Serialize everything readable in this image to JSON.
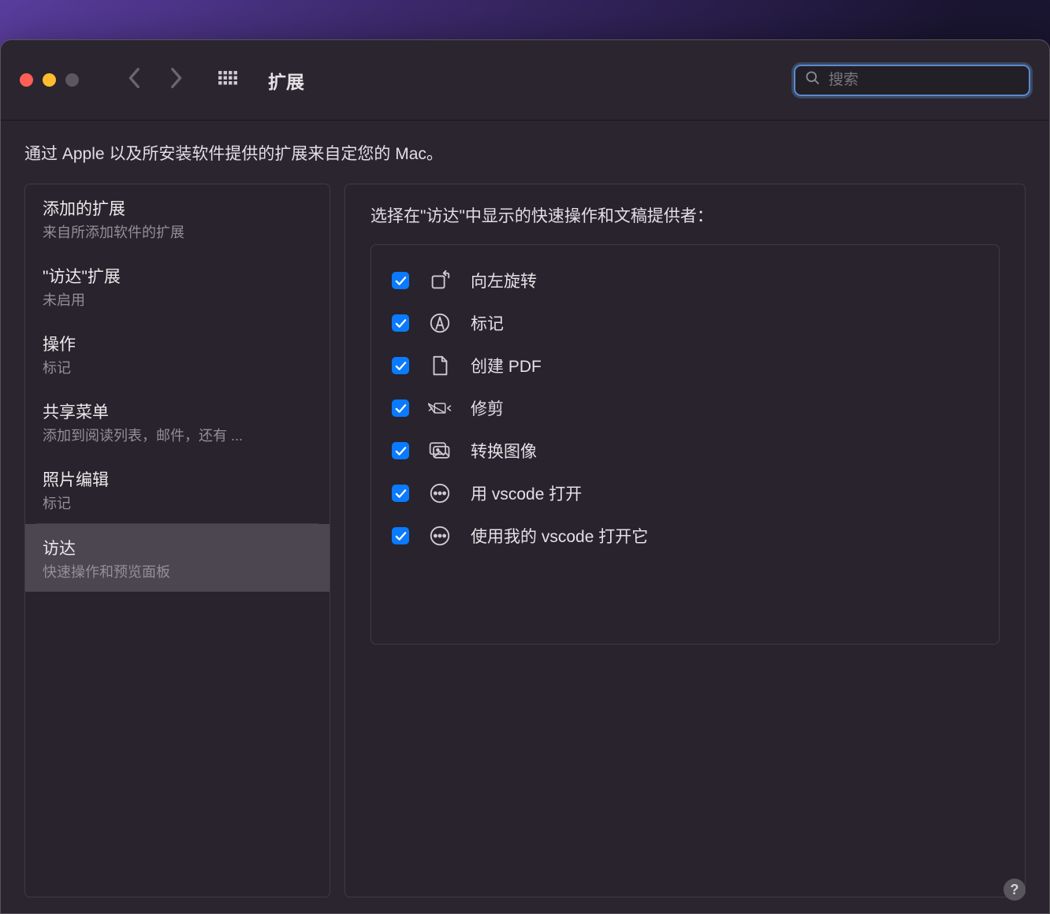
{
  "window": {
    "title": "扩展"
  },
  "search": {
    "placeholder": "搜索",
    "value": ""
  },
  "description": "通过 Apple 以及所安装软件提供的扩展来自定您的 Mac。",
  "sidebar": {
    "items": [
      {
        "title": "添加的扩展",
        "subtitle": "来自所添加软件的扩展",
        "selected": false
      },
      {
        "title": "\"访达\"扩展",
        "subtitle": "未启用",
        "selected": false
      },
      {
        "title": "操作",
        "subtitle": "标记",
        "selected": false
      },
      {
        "title": "共享菜单",
        "subtitle": "添加到阅读列表，邮件，还有 ...",
        "selected": false
      },
      {
        "title": "照片编辑",
        "subtitle": "标记",
        "selected": false
      },
      {
        "title": "访达",
        "subtitle": "快速操作和预览面板",
        "selected": true
      }
    ]
  },
  "main": {
    "heading": "选择在\"访达\"中显示的快速操作和文稿提供者：",
    "items": [
      {
        "label": "向左旋转",
        "checked": true,
        "icon": "rotate-left"
      },
      {
        "label": "标记",
        "checked": true,
        "icon": "markup"
      },
      {
        "label": "创建 PDF",
        "checked": true,
        "icon": "pdf"
      },
      {
        "label": "修剪",
        "checked": true,
        "icon": "trim"
      },
      {
        "label": "转换图像",
        "checked": true,
        "icon": "convert-image"
      },
      {
        "label": "用 vscode 打开",
        "checked": true,
        "icon": "ellipsis"
      },
      {
        "label": "使用我的 vscode 打开它",
        "checked": true,
        "icon": "ellipsis"
      }
    ]
  },
  "help": {
    "label": "?"
  }
}
